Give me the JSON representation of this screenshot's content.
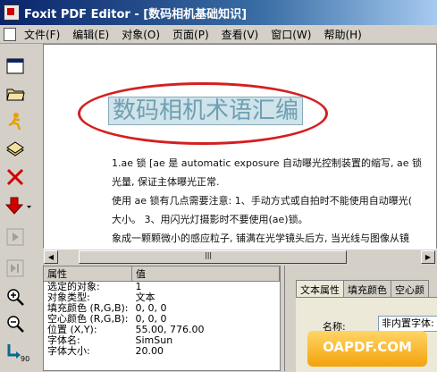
{
  "window": {
    "title": "Foxit PDF Editor - [数码相机基础知识]",
    "app_name": "Foxit PDF Editor"
  },
  "menubar": {
    "items": [
      {
        "label": "文件(F)"
      },
      {
        "label": "编辑(E)"
      },
      {
        "label": "对象(O)"
      },
      {
        "label": "页面(P)"
      },
      {
        "label": "查看(V)"
      },
      {
        "label": "窗口(W)"
      },
      {
        "label": "帮助(H)"
      }
    ]
  },
  "toolbar": {
    "icons": [
      "window-icon",
      "open-folder-icon",
      "runner-icon",
      "layer-icon",
      "delete-icon",
      "download-icon",
      "play-icon",
      "next-icon",
      "zoom-in-icon",
      "zoom-out-icon",
      "rotate-icon"
    ]
  },
  "document": {
    "selected_text": "数码相机术语汇编",
    "lines": [
      "1.ae 锁 [ae 是 automatic exposure 自动曝光控制装置的缩写, ae 锁",
      "光量, 保证主体曝光正常.",
      "使用 ae 锁有几点需要注意: 1、手动方式或自拍时不能使用自动曝光(",
      "大小。 3、用闪光灯摄影时不要使用(ae)锁。",
      "象成一颗颗微小的感应粒子, 铺满在光学镜头后方, 当光线与图像从镜"
    ]
  },
  "properties": {
    "header": {
      "col1": "属性",
      "col2": "值"
    },
    "rows": [
      {
        "name": "选定的对象:",
        "value": "1"
      },
      {
        "name": "对象类型:",
        "value": "文本"
      },
      {
        "name": "填充颜色 (R,G,B):",
        "value": "0, 0, 0"
      },
      {
        "name": "空心颜色 (R,G,B):",
        "value": "0, 0, 0"
      },
      {
        "name": "位置 (X,Y):",
        "value": "55.00, 776.00"
      },
      {
        "name": "字体名:",
        "value": "SimSun"
      },
      {
        "name": "字体大小:",
        "value": "20.00"
      }
    ]
  },
  "text_panel": {
    "tabs": [
      {
        "label": "文本属性"
      },
      {
        "label": "填充颜色"
      },
      {
        "label": "空心颜"
      }
    ],
    "font_label": "名称:",
    "font_value": "非内置字体:"
  },
  "watermark": {
    "text": "OAPDF.COM"
  },
  "colors": {
    "title_gradient_start": "#0a246a",
    "title_gradient_end": "#a6caf0",
    "highlight_ellipse": "#d42020",
    "selection_bg": "#cfe3ea"
  }
}
